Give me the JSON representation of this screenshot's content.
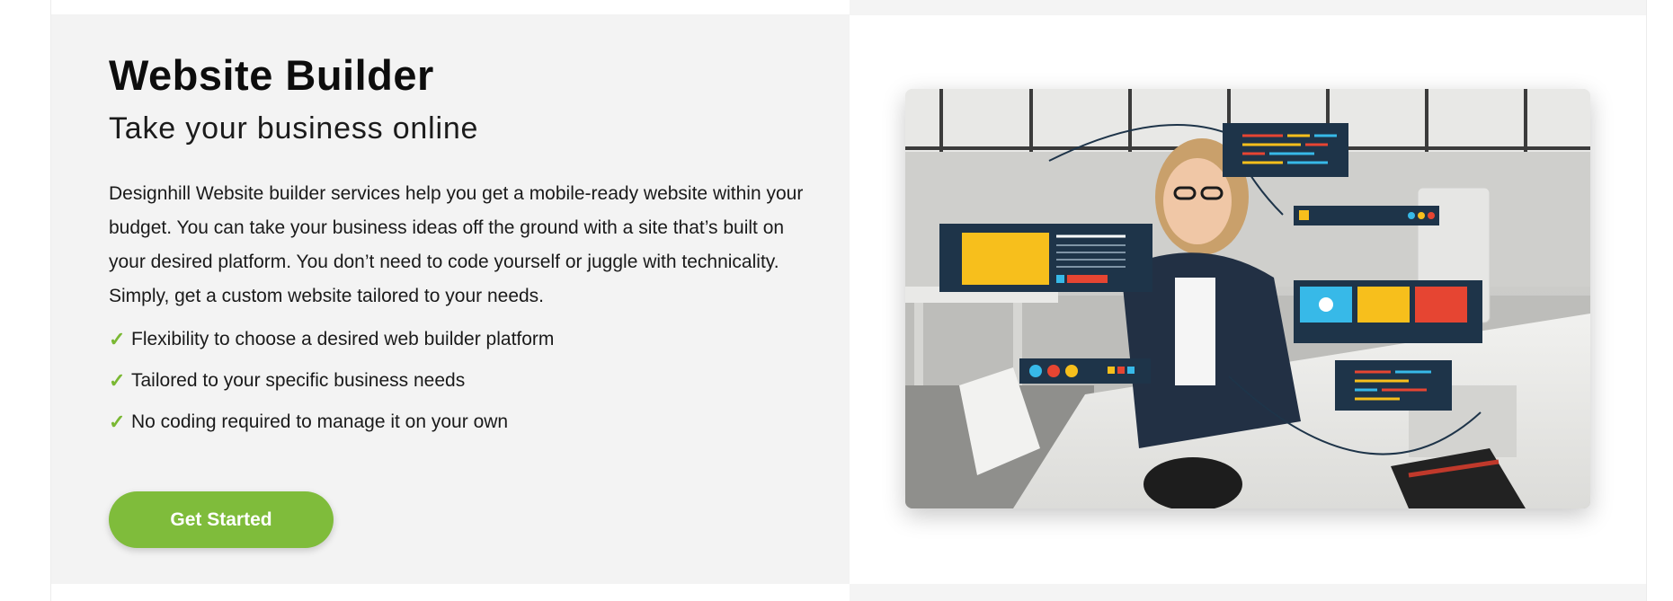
{
  "section": {
    "title": "Website Builder",
    "subtitle": "Take your business online",
    "description": "Designhill Website builder services help you get a mobile-ready website within your budget. You can take your business ideas off the ground with a site that’s built on your desired platform. You don’t need to code yourself or juggle with technicality. Simply, get a custom website tailored to your needs.",
    "features": [
      "Flexibility to choose a desired web builder platform",
      "Tailored to your specific business needs",
      "No coding required to manage it on your own"
    ],
    "check_icon": "✓",
    "cta_label": "Get Started"
  },
  "colors": {
    "accent": "#7fbc3b",
    "panel_background": "#f3f3f3",
    "text": "#1a1a1a"
  },
  "hero_image": {
    "icon": "hero-illustration",
    "overlay_colors": [
      "#1e3449",
      "#f7bf1c",
      "#e64532",
      "#37b9e8"
    ]
  }
}
